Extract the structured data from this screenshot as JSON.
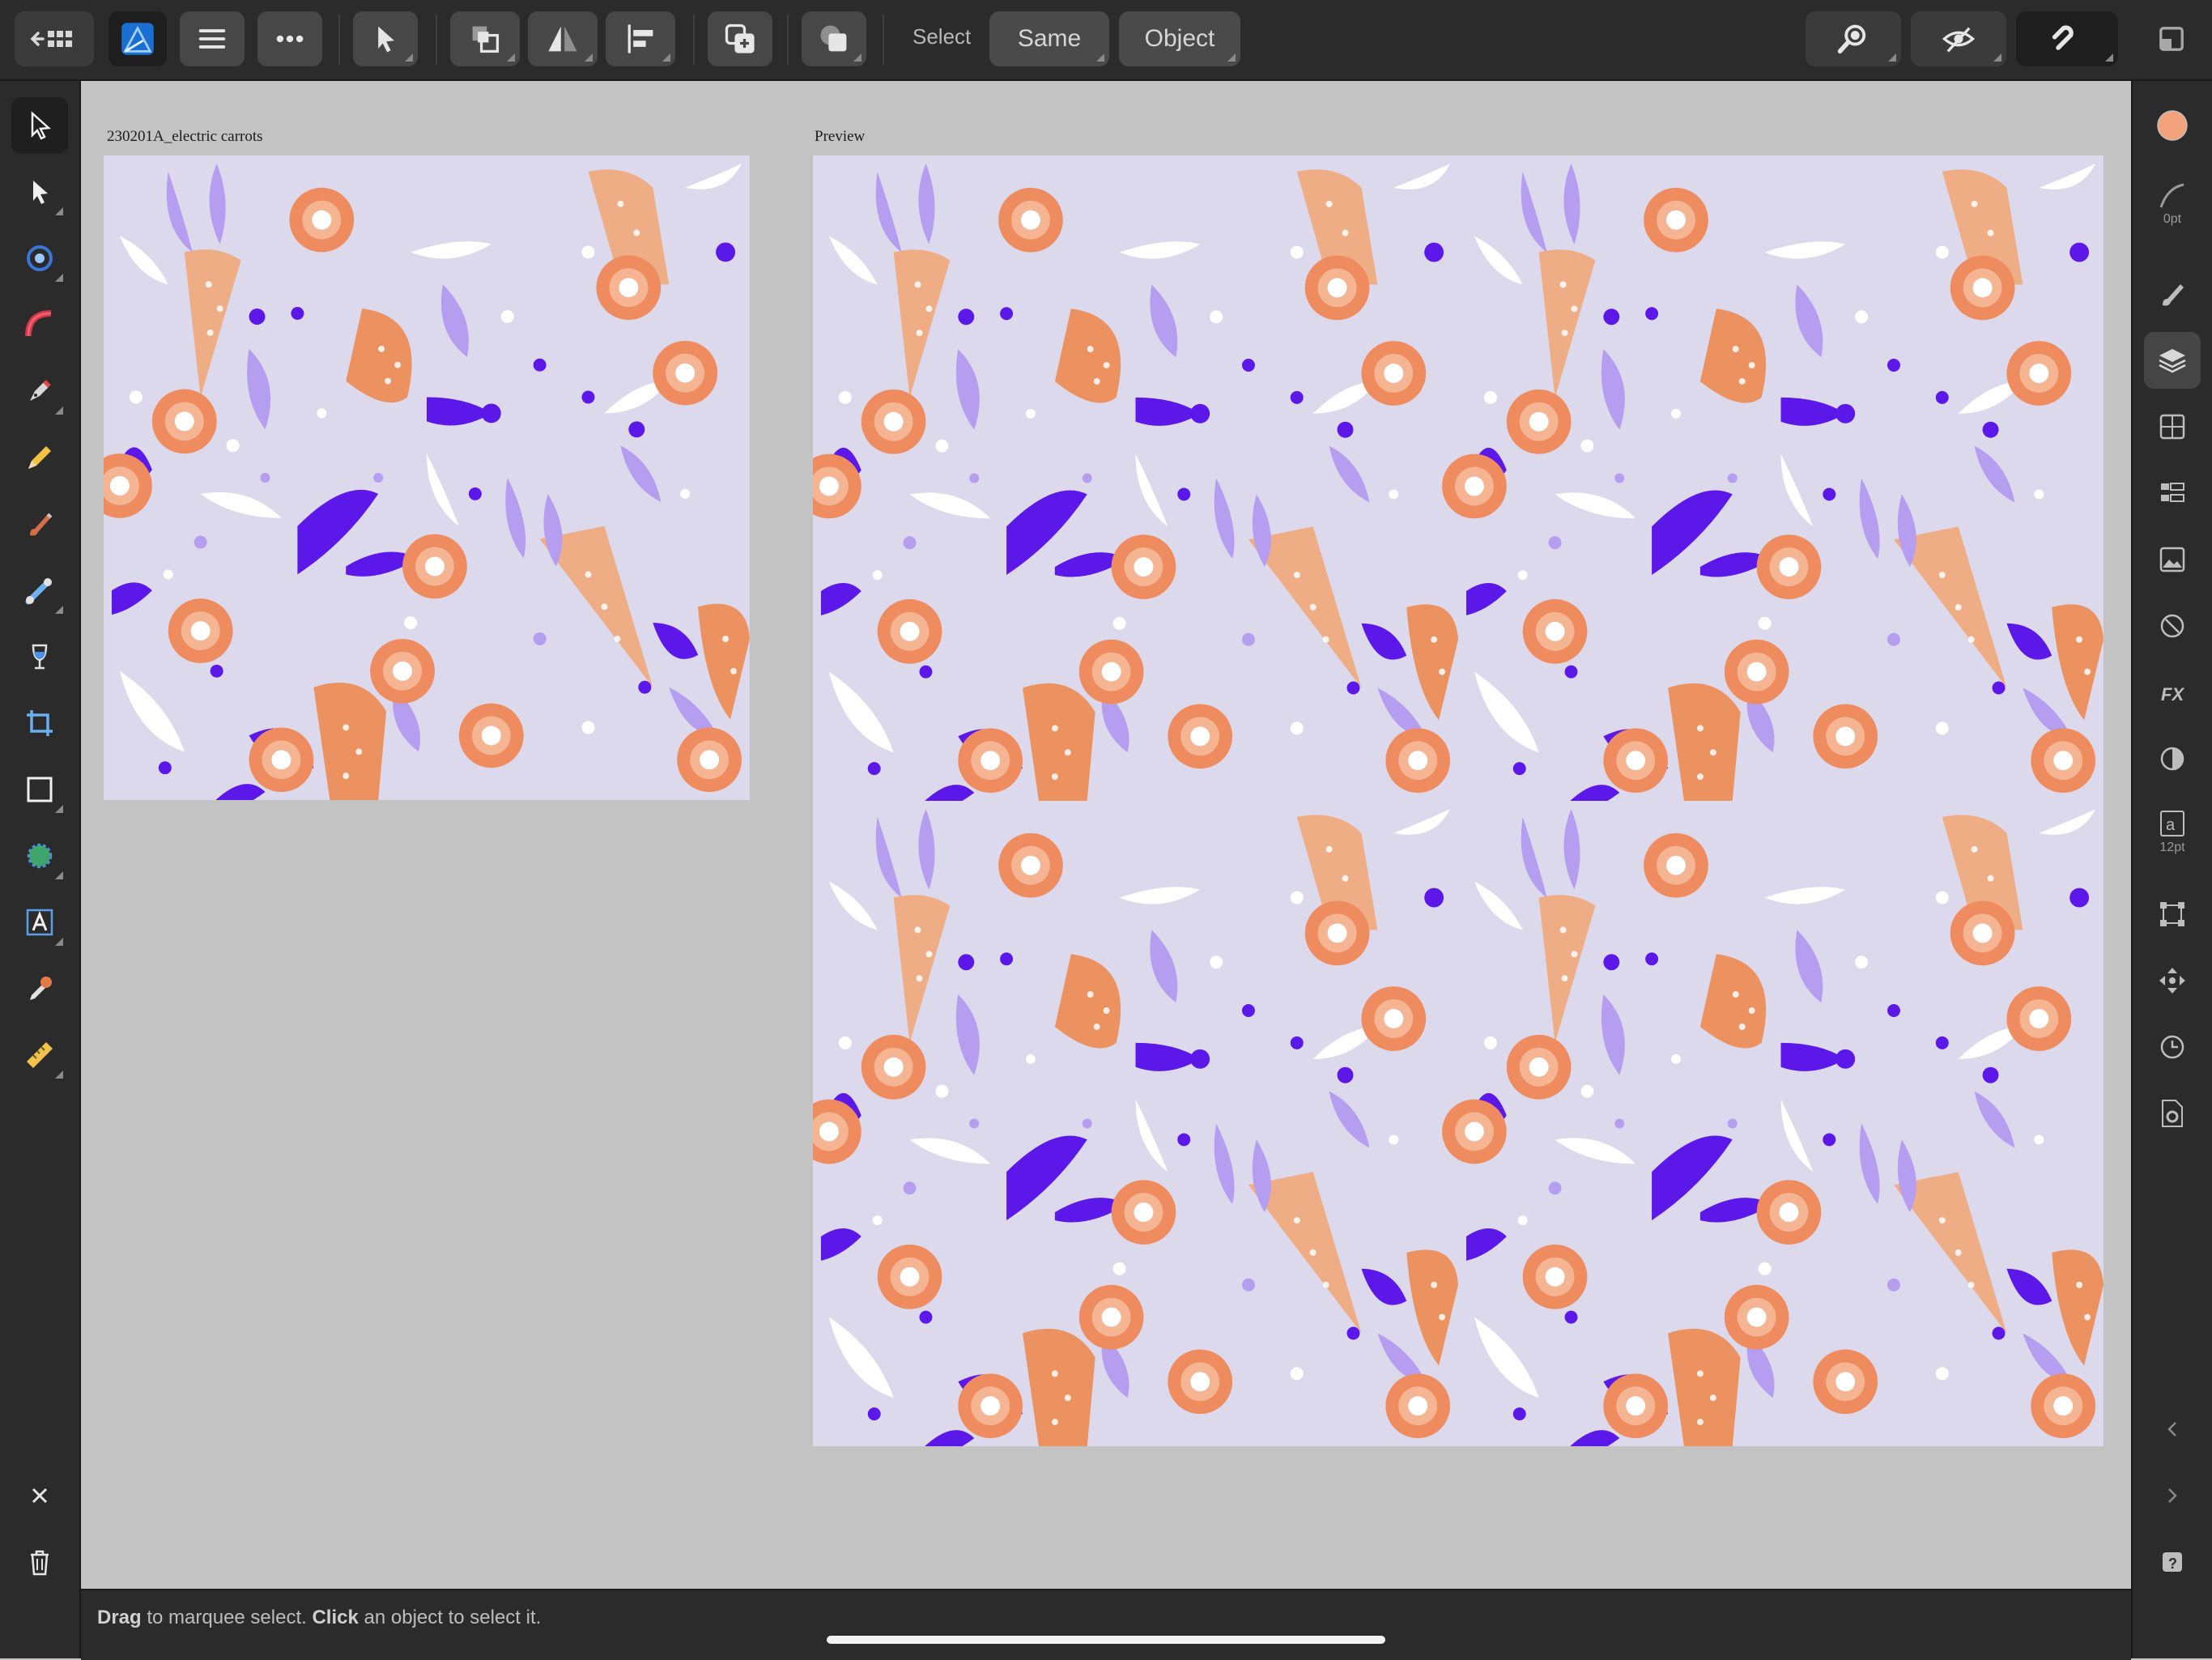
{
  "toolbar": {
    "select_label": "Select",
    "same_label": "Same",
    "object_label": "Object"
  },
  "canvas": {
    "artboard_title": "230201A_electric carrots",
    "preview_title": "Preview"
  },
  "right_panel": {
    "stroke_width": "0pt",
    "text_size": "12pt",
    "fill_color": "#f2a37c"
  },
  "status": {
    "drag_word": "Drag",
    "drag_rest": " to marquee select. ",
    "click_word": "Click",
    "click_rest": " an object to select it."
  },
  "pattern_colors": {
    "background": "#dcd9ec",
    "carrot_light": "#efad86",
    "carrot_dark": "#ec9160",
    "violet": "#5b18e8",
    "lavender": "#b59ef0",
    "white": "#ffffff",
    "flower_outer": "#ef8c5f",
    "flower_inner": "#f6b592"
  },
  "icons": {
    "back": "back-grid-icon",
    "app": "affinity-designer-icon",
    "menu": "hamburger-icon",
    "more": "ellipsis-icon"
  }
}
